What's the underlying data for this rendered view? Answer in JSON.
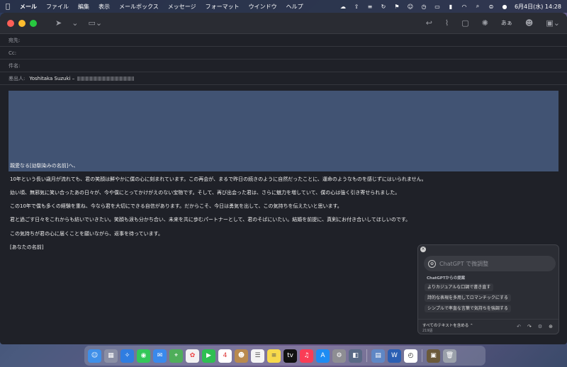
{
  "menubar": {
    "app": "メール",
    "items": [
      "ファイル",
      "編集",
      "表示",
      "メールボックス",
      "メッセージ",
      "フォーマット",
      "ウインドウ",
      "ヘルプ"
    ],
    "clock": "6月4日(水) 14:28"
  },
  "toolbar": {
    "text_label": "あぁ"
  },
  "header": {
    "to_label": "宛先:",
    "cc_label": "Cc:",
    "subject_label": "件名:",
    "from_label": "差出人:",
    "from_value": "Yoshitaka Suzuki –"
  },
  "body": {
    "lines": [
      "親愛なる[幼馴染みの名前]へ、",
      "10年という長い歳月が流れても、君の笑顔は鮮やかに僕の心に刻まれています。この再会が、まるで昨日の続きのように自然だったことに、運命のようなものを感じずにはいられません。",
      "幼い頃、無邪気に笑い合ったあの日々が、今や僕にとってかけがえのない宝物です。そして、再び出会った君は、さらに魅力を増していて、僕の心は強く引き寄せられました。",
      "この10年で僕も多くの経験を重ね、今なら君を大切にできる自信があります。だからこそ、今日は勇気を出して、この気持ちを伝えたいと思います。",
      "君と過ごす日々をこれからも紡いでいきたい。笑顔も涙も分かち合い、未来を共に歩むパートナーとして、君のそばにいたい。結婚を前提に、真剣にお付き合いしてほしいのです。",
      "この気持ちが君の心に届くことを願いながら、返事を待っています。",
      "[あなたの名前]"
    ]
  },
  "chatgpt": {
    "input_placeholder": "ChatGPT で微調整",
    "suggestions_title": "ChatGPTからの提案",
    "suggestions": [
      "よりカジュアルな口調で書き直す",
      "詩的な表現を多用してロマンチックにする",
      "シンプルで率直な言葉で気持ちを強調する"
    ],
    "scope_label": "すべてのテキストを含める ⌃",
    "char_count": "219語"
  }
}
